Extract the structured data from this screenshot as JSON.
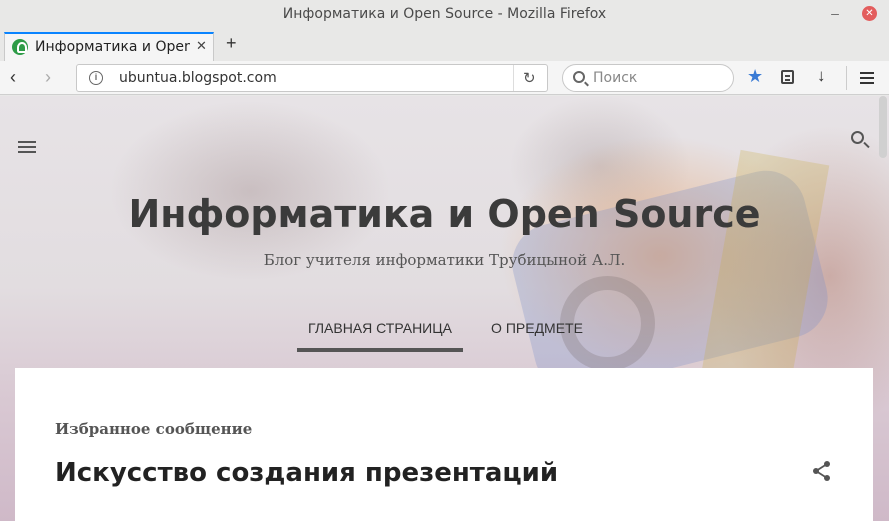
{
  "window": {
    "title": "Информатика и Open Source - Mozilla Firefox",
    "minimize_glyph": "–",
    "close_glyph": "✕"
  },
  "tabs": [
    {
      "label": "Информатика и Open Source",
      "favicon": "blogger-icon",
      "close_glyph": "✕"
    }
  ],
  "tabstrip": {
    "new_tab_glyph": "+"
  },
  "navbar": {
    "back_glyph": "‹",
    "forward_glyph": "›",
    "url": "ubuntua.blogspot.com",
    "info_glyph": "i",
    "reload_glyph": "↻",
    "search_placeholder": "Поиск",
    "bookmark_glyph": "★",
    "download_glyph": "↓",
    "colors": {
      "accent": "#0a84ff",
      "bookmark": "#3a7bd5"
    }
  },
  "blog": {
    "title": "Информатика и Open Source",
    "subtitle": "Блог учителя информатики Трубицыной А.Л.",
    "nav": [
      {
        "label": "ГЛАВНАЯ СТРАНИЦА",
        "active": true
      },
      {
        "label": "О ПРЕДМЕТЕ",
        "active": false
      }
    ]
  },
  "post": {
    "featured_label": "Избранное сообщение",
    "title": "Искусство создания презентаций"
  }
}
